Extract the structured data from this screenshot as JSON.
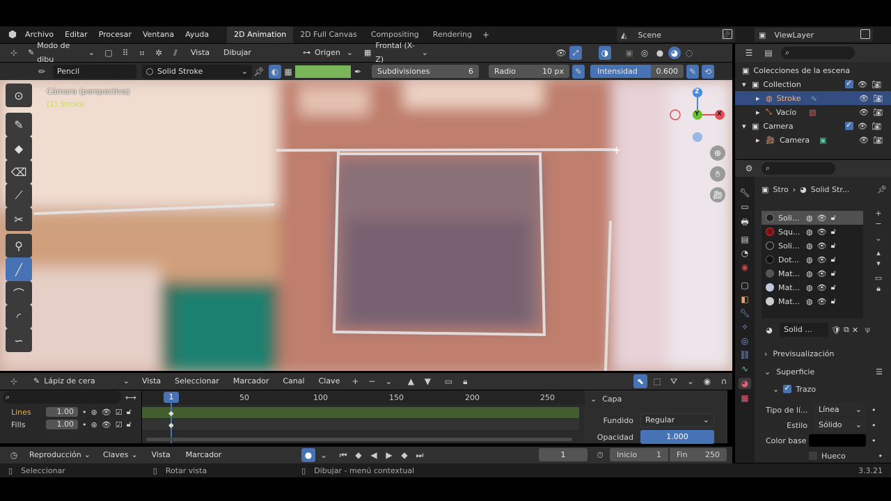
{
  "topbar": {
    "menus": [
      "Archivo",
      "Editar",
      "Procesar",
      "Ventana",
      "Ayuda"
    ],
    "workspaces": [
      "2D Animation",
      "2D Full Canvas",
      "Compositing",
      "Rendering"
    ],
    "scene": "Scene",
    "view_layer": "ViewLayer"
  },
  "viewport_header": {
    "mode": "Modo de dibu",
    "view": "Vista",
    "draw": "Dibujar",
    "origin": "Origen",
    "view_axis": "Frontal (X-Z)"
  },
  "tool_settings": {
    "brush_name": "Pencil",
    "material": "Solid Stroke",
    "subdivisions_label": "Subdivisiones",
    "subdivisions_value": "6",
    "radius_label": "Radio",
    "radius_value": "10 px",
    "strength_label": "Intensidad",
    "strength_value": "0.600",
    "color": "#7bb55a"
  },
  "viewport": {
    "camera_label": "Cámara (perspectiva)",
    "object_label": "(1) Stroke",
    "axes": {
      "z": "Z",
      "y": "Y",
      "x": "X"
    }
  },
  "outliner": {
    "title": "Colecciones de la escena",
    "rows": [
      {
        "label": "Collection"
      },
      {
        "label": "Stroke"
      },
      {
        "label": "Vacío"
      },
      {
        "label": "Camera"
      },
      {
        "label": "Camera"
      }
    ]
  },
  "properties": {
    "breadcrumb_obj": "Stro",
    "breadcrumb_mat": "Solid Str...",
    "materials": [
      "Soli...",
      "Squ...",
      "Soli...",
      "Dot...",
      "Mat...",
      "Mat...",
      "Mat..."
    ],
    "active_material": "Solid ...",
    "preview": "Previsualización",
    "surface": "Superficie",
    "stroke": "Trazo",
    "line_type_label": "Tipo de lí...",
    "line_type_value": "Línea",
    "style_label": "Estilo",
    "style_value": "Sólido",
    "base_color_label": "Color base",
    "hollow": "Hueco"
  },
  "dopesheet": {
    "mode": "Lápiz de cera",
    "menus": [
      "Vista",
      "Seleccionar",
      "Marcador",
      "Canal",
      "Clave"
    ],
    "channels": [
      {
        "name": "Lines",
        "value": "1.00"
      },
      {
        "name": "Fills",
        "value": "1.00"
      }
    ],
    "ticks": [
      "1",
      "50",
      "100",
      "150",
      "200",
      "250"
    ],
    "side_panel": {
      "title": "Capa",
      "blend_label": "Fundido",
      "blend_value": "Regular",
      "opacity_label": "Opacidad",
      "opacity_value": "1.000"
    }
  },
  "timeline": {
    "playback": "Reproducción",
    "keys": "Claves",
    "view": "Vista",
    "marker": "Marcador",
    "current_frame": "1",
    "start_label": "Inicio",
    "start_value": "1",
    "end_label": "Fin",
    "end_value": "250"
  },
  "statusbar": {
    "select": "Seleccionar",
    "rotate": "Rotar vista",
    "context": "Dibujar - menú contextual",
    "version": "3.3.21"
  }
}
